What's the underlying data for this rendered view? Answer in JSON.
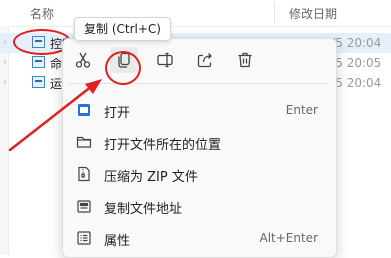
{
  "columns": {
    "name": "名称",
    "date": "修改日期"
  },
  "files": [
    {
      "name": "控制",
      "date": "2021/6/5 20:04"
    },
    {
      "name": "命",
      "date": "2021/6/5 20:05"
    },
    {
      "name": "运",
      "date": "2021/6/5 20:04"
    }
  ],
  "tooltip": {
    "text": "复制 (Ctrl+C)"
  },
  "quick_actions": [
    {
      "name": "cut",
      "icon": "scissors-icon"
    },
    {
      "name": "copy",
      "icon": "copy-icon"
    },
    {
      "name": "rename",
      "icon": "rename-icon"
    },
    {
      "name": "share",
      "icon": "share-icon"
    },
    {
      "name": "delete",
      "icon": "trash-icon"
    }
  ],
  "menu": {
    "items": [
      {
        "label": "打开",
        "shortcut": "Enter",
        "icon": "open-app-icon"
      },
      {
        "label": "打开文件所在的位置",
        "shortcut": "",
        "icon": "folder-icon"
      },
      {
        "label": "压缩为 ZIP 文件",
        "shortcut": "",
        "icon": "zip-icon"
      },
      {
        "label": "复制文件地址",
        "shortcut": "",
        "icon": "copy-path-icon"
      },
      {
        "label": "属性",
        "shortcut": "Alt+Enter",
        "icon": "properties-icon"
      }
    ]
  },
  "annotation": {
    "color": "#e02020"
  }
}
